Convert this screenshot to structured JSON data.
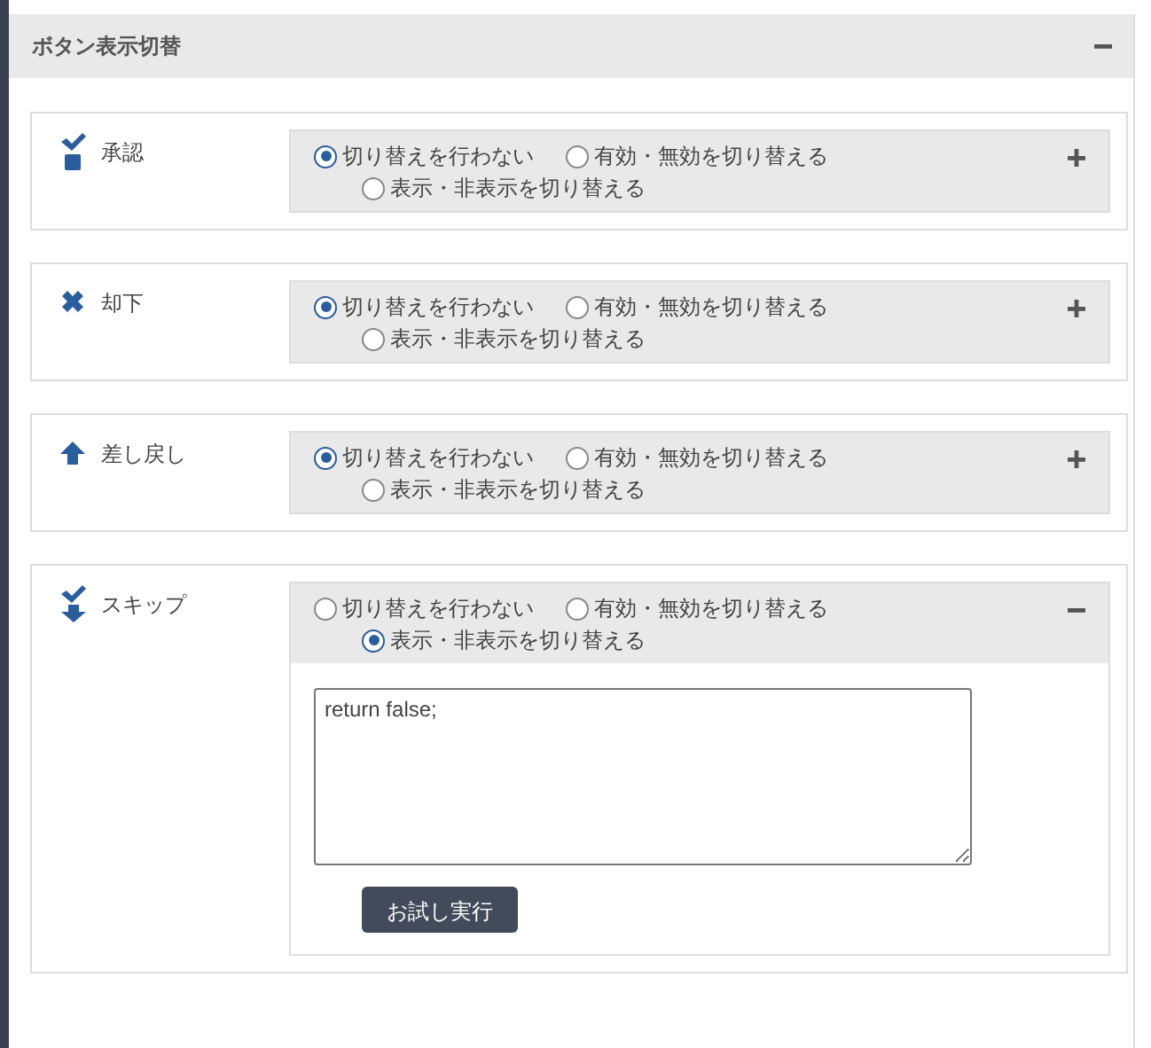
{
  "section": {
    "title": "ボタン表示切替",
    "expanded": true
  },
  "buttons": [
    {
      "label": "承認",
      "kind": "approve",
      "expanded": false,
      "options": [
        {
          "label": "切り替えを行わない",
          "selected": true
        },
        {
          "label": "有効・無効を切り替える",
          "selected": false
        },
        {
          "label": "表示・非表示を切り替える",
          "selected": false
        }
      ]
    },
    {
      "label": "却下",
      "kind": "reject",
      "expanded": false,
      "options": [
        {
          "label": "切り替えを行わない",
          "selected": true
        },
        {
          "label": "有効・無効を切り替える",
          "selected": false
        },
        {
          "label": "表示・非表示を切り替える",
          "selected": false
        }
      ]
    },
    {
      "label": "差し戻し",
      "kind": "return",
      "expanded": false,
      "options": [
        {
          "label": "切り替えを行わない",
          "selected": true
        },
        {
          "label": "有効・無効を切り替える",
          "selected": false
        },
        {
          "label": "表示・非表示を切り替える",
          "selected": false
        }
      ]
    },
    {
      "label": "スキップ",
      "kind": "skip",
      "expanded": true,
      "options": [
        {
          "label": "切り替えを行わない",
          "selected": false
        },
        {
          "label": "有効・無効を切り替える",
          "selected": false
        },
        {
          "label": "表示・非表示を切り替える",
          "selected": true
        }
      ],
      "script": "return false;",
      "test_button": "お試し実行"
    }
  ]
}
